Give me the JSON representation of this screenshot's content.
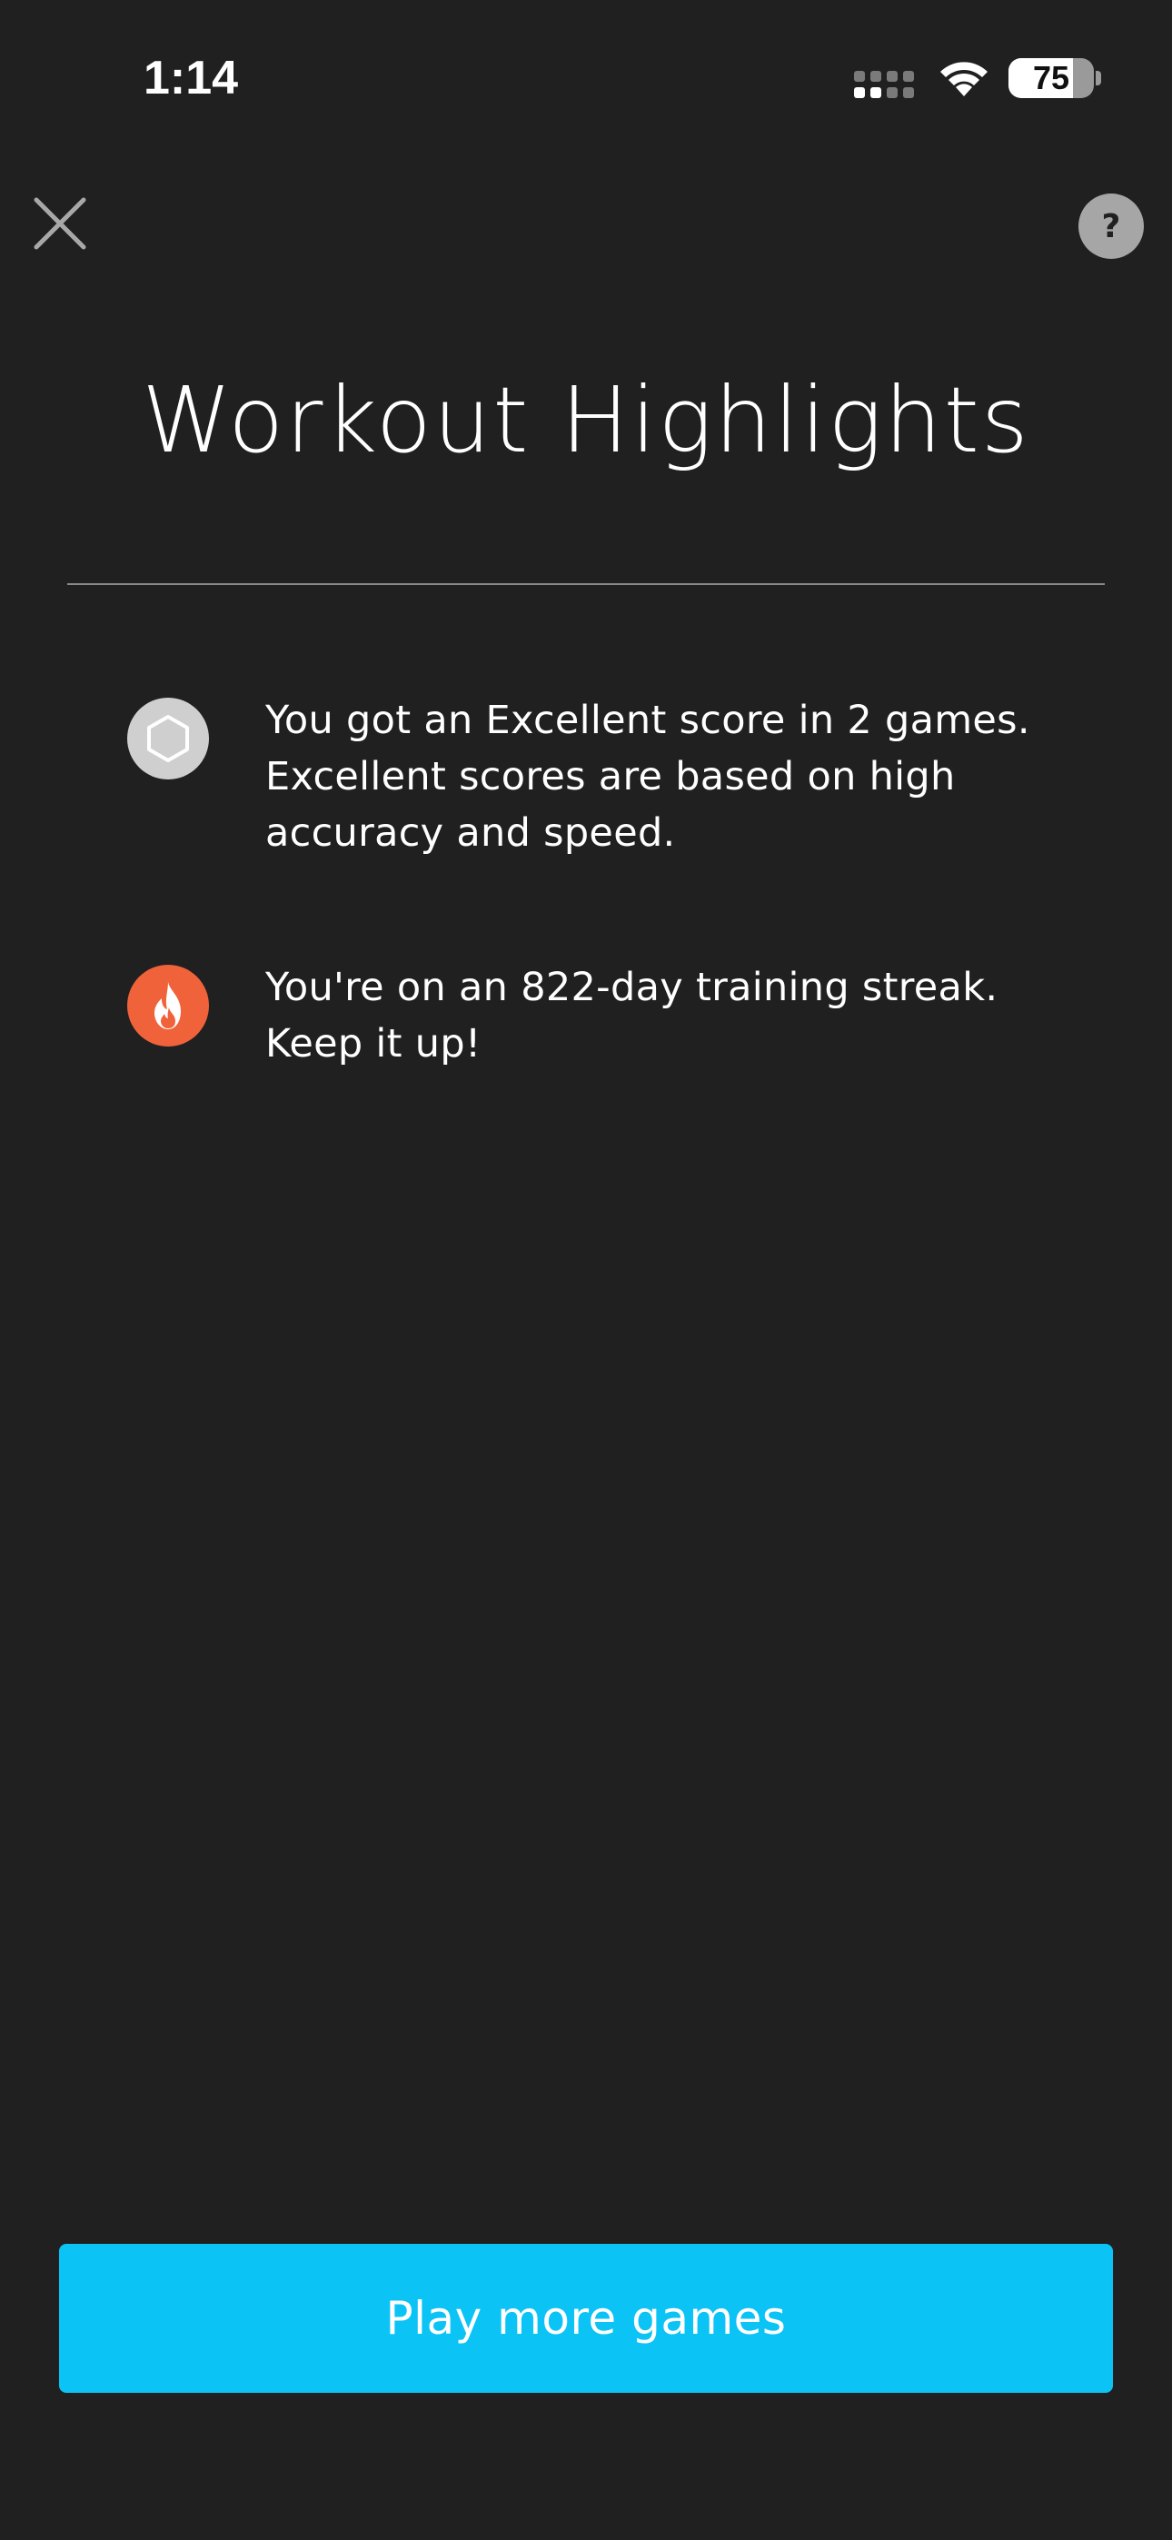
{
  "status_bar": {
    "time": "1:14",
    "battery_level": "75",
    "battery_fraction": 0.75,
    "icons": [
      "signal-icon",
      "wifi-icon",
      "battery-icon"
    ]
  },
  "header": {
    "close_icon": "close-icon",
    "help_label": "?"
  },
  "title": "Workout Highlights",
  "highlights": [
    {
      "icon": "excellent-hexagon-icon",
      "icon_color": "#cfcfcf",
      "text": "You got an Excellent score in 2 games. Excellent scores are based on high accuracy and speed."
    },
    {
      "icon": "flame-icon",
      "icon_color": "#f0623a",
      "text": "You're on an 822-day training streak. Keep it up!"
    }
  ],
  "cta": {
    "label": "Play more games",
    "color": "#0cc3f5"
  },
  "colors": {
    "background": "#202020",
    "text": "#ffffff",
    "divider": "#8a8a8a"
  }
}
